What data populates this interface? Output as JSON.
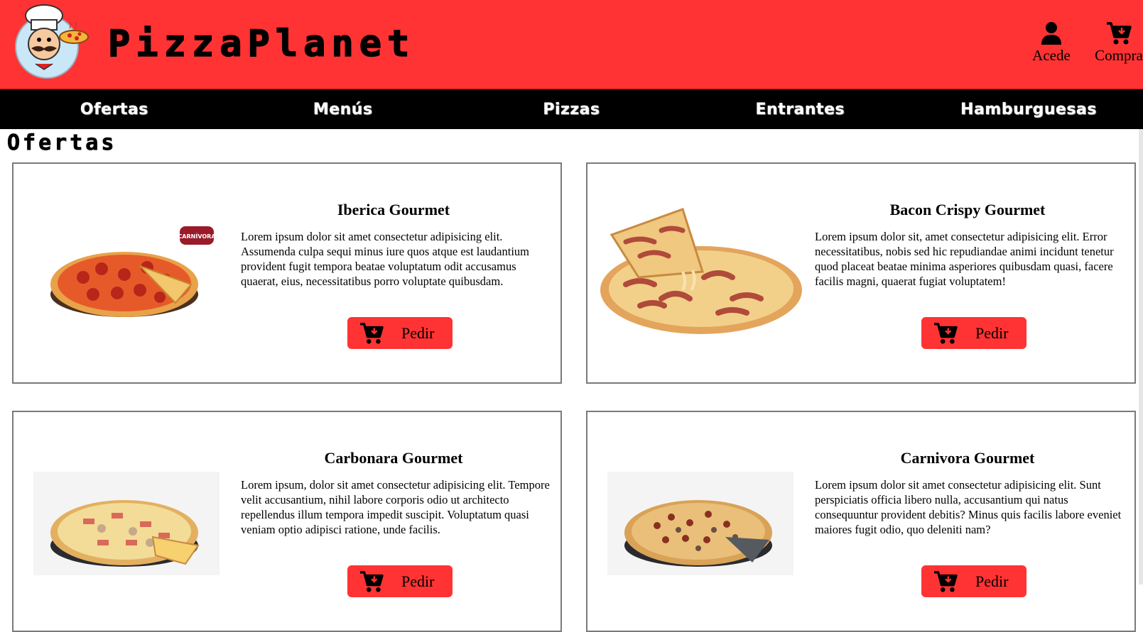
{
  "header": {
    "brand": "PizzaPlanet",
    "logo_icon": "chef-logo-icon",
    "account_label": "Acede",
    "cart_label": "Compra"
  },
  "nav": {
    "items": [
      {
        "label": "Ofertas"
      },
      {
        "label": "Menús"
      },
      {
        "label": "Pizzas"
      },
      {
        "label": "Entrantes"
      },
      {
        "label": "Hamburguesas"
      }
    ]
  },
  "main": {
    "section_title": "Ofertas",
    "cards": [
      {
        "title": "Iberica Gourmet",
        "description": "Lorem ipsum dolor sit amet consectetur adipisicing elit. Assumenda culpa sequi minus iure quos atque est laudantium provident fugit tempora beatae voluptatum odit accusamus quaerat, eius, necessitatibus porro voluptate quibusdam.",
        "button_label": "Pedir",
        "badge_text": "CARNÍVORA"
      },
      {
        "title": "Bacon Crispy Gourmet",
        "description": "Lorem ipsum dolor sit, amet consectetur adipisicing elit. Error necessitatibus, nobis sed hic repudiandae animi incidunt tenetur quod placeat beatae minima asperiores quibusdam quasi, facere facilis magni, quaerat fugiat voluptatem!",
        "button_label": "Pedir"
      },
      {
        "title": "Carbonara Gourmet",
        "description": "Lorem ipsum, dolor sit amet consectetur adipisicing elit. Tempore velit accusantium, nihil labore corporis odio ut architecto repellendus illum tempora impedit suscipit. Voluptatum quasi veniam optio adipisci ratione, unde facilis.",
        "button_label": "Pedir"
      },
      {
        "title": "Carnivora Gourmet",
        "description": "Lorem ipsum dolor sit amet consectetur adipisicing elit. Sunt perspiciatis officia libero nulla, accusantium qui natus consequuntur provident debitis? Minus quis facilis labore eveniet maiores fugit odio, quo deleniti nam?",
        "button_label": "Pedir"
      }
    ]
  },
  "colors": {
    "brand_red": "#ff3333",
    "nav_black": "#000000"
  }
}
